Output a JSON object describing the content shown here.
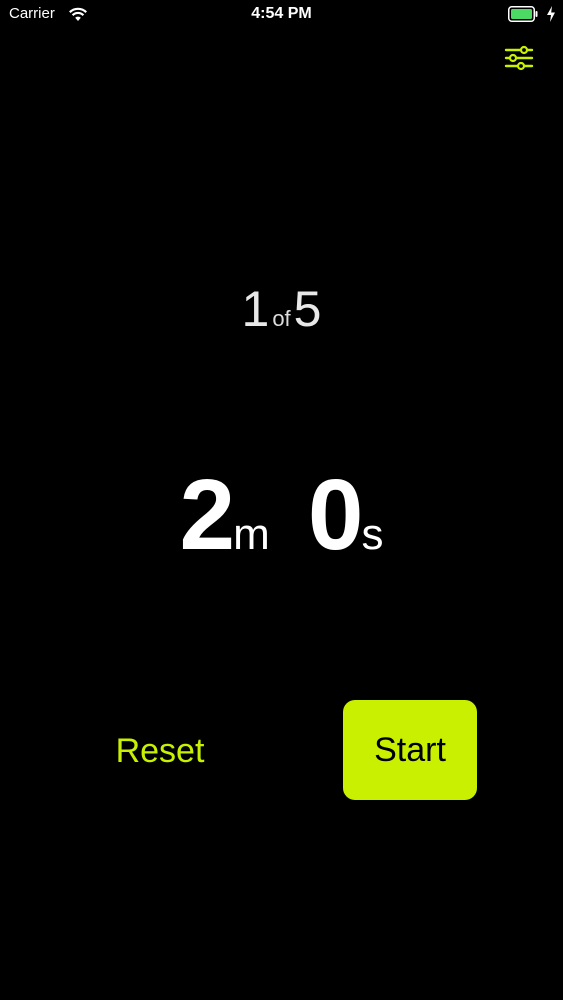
{
  "status_bar": {
    "carrier": "Carrier",
    "time": "4:54 PM"
  },
  "toolbar": {
    "settings_icon": "sliders-icon"
  },
  "round": {
    "current": "1",
    "separator": "of",
    "total": "5"
  },
  "timer": {
    "minutes": "2",
    "minutes_unit": "m",
    "seconds": "0",
    "seconds_unit": "s"
  },
  "controls": {
    "reset_label": "Reset",
    "start_label": "Start"
  },
  "colors": {
    "accent": "#c8f000",
    "background": "#000000",
    "battery": "#4cd964"
  }
}
